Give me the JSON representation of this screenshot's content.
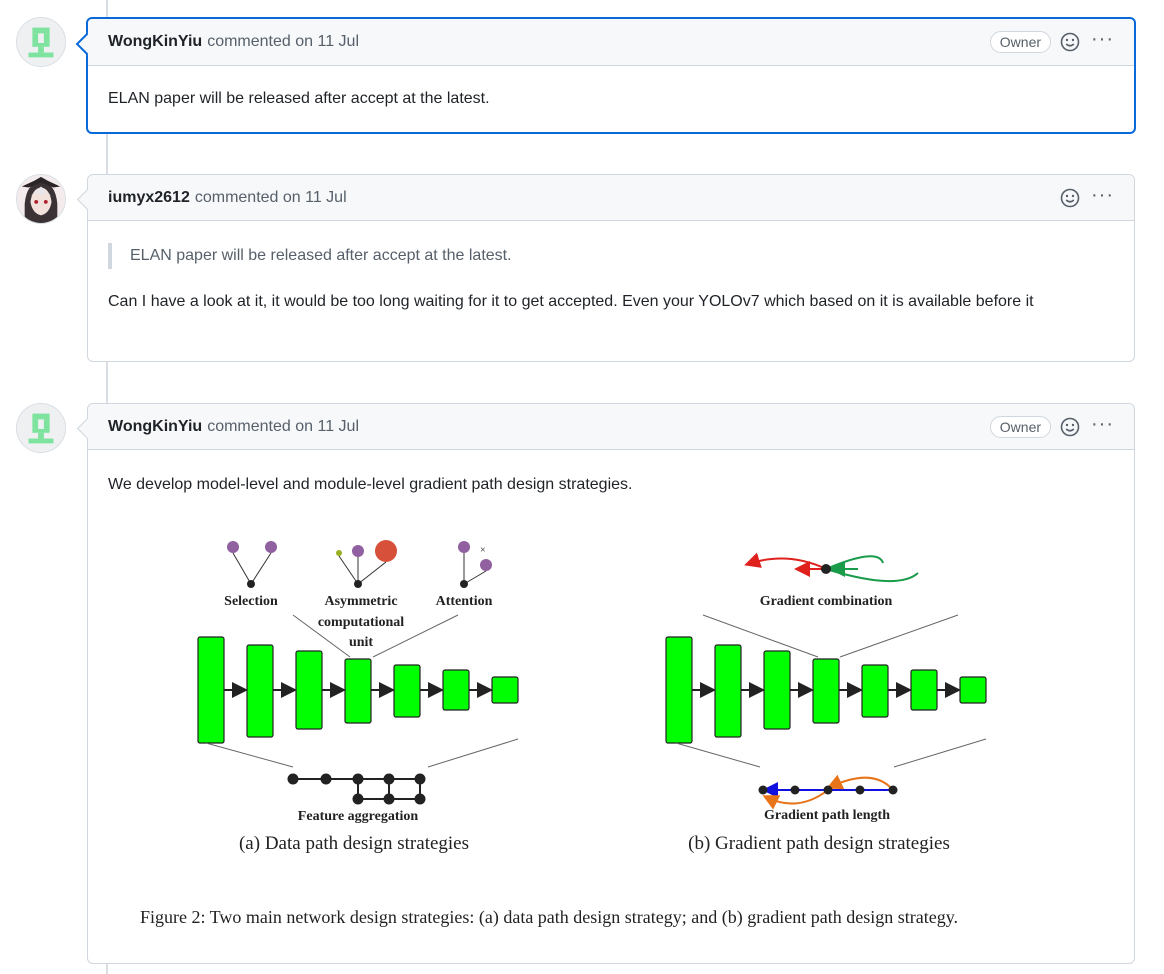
{
  "comments": [
    {
      "author": "WongKinYiu",
      "meta": "commented on 11 Jul",
      "badge": "Owner",
      "body": "ELAN paper will be released after accept at the latest."
    },
    {
      "author": "iumyx2612",
      "meta": "commented on 11 Jul",
      "quote": "ELAN paper will be released after accept at the latest.",
      "body": "Can I have a look at it, it would be too long waiting for it to get accepted. Even your YOLOv7 which based on it is available before it"
    },
    {
      "author": "WongKinYiu",
      "meta": "commented on 11 Jul",
      "badge": "Owner",
      "body": "We develop model-level and module-level gradient path design strategies.",
      "figure": {
        "left_labels": {
          "selection": "Selection",
          "asym_line1": "Asymmetric",
          "asym_line2": "computational",
          "asym_line3": "unit",
          "attention": "Attention",
          "feature": "Feature aggregation",
          "caption": "(a) Data path design strategies"
        },
        "right_labels": {
          "combination": "Gradient combination",
          "length": "Gradient path length",
          "caption": "(b) Gradient path design strategies"
        },
        "caption": "Figure 2: Two main network design strategies: (a) data path design strategy; and (b) gradient path design strategy."
      }
    }
  ],
  "icons": {
    "reaction": "smiley-icon",
    "more": "kebab-icon"
  },
  "colors": {
    "accent": "#0969da",
    "block_green": "#00ff00",
    "red_arrow": "#e0201c",
    "green_arrow": "#1a9b4a",
    "blue_arrow": "#1010e0",
    "orange_arrow": "#e8741a"
  }
}
